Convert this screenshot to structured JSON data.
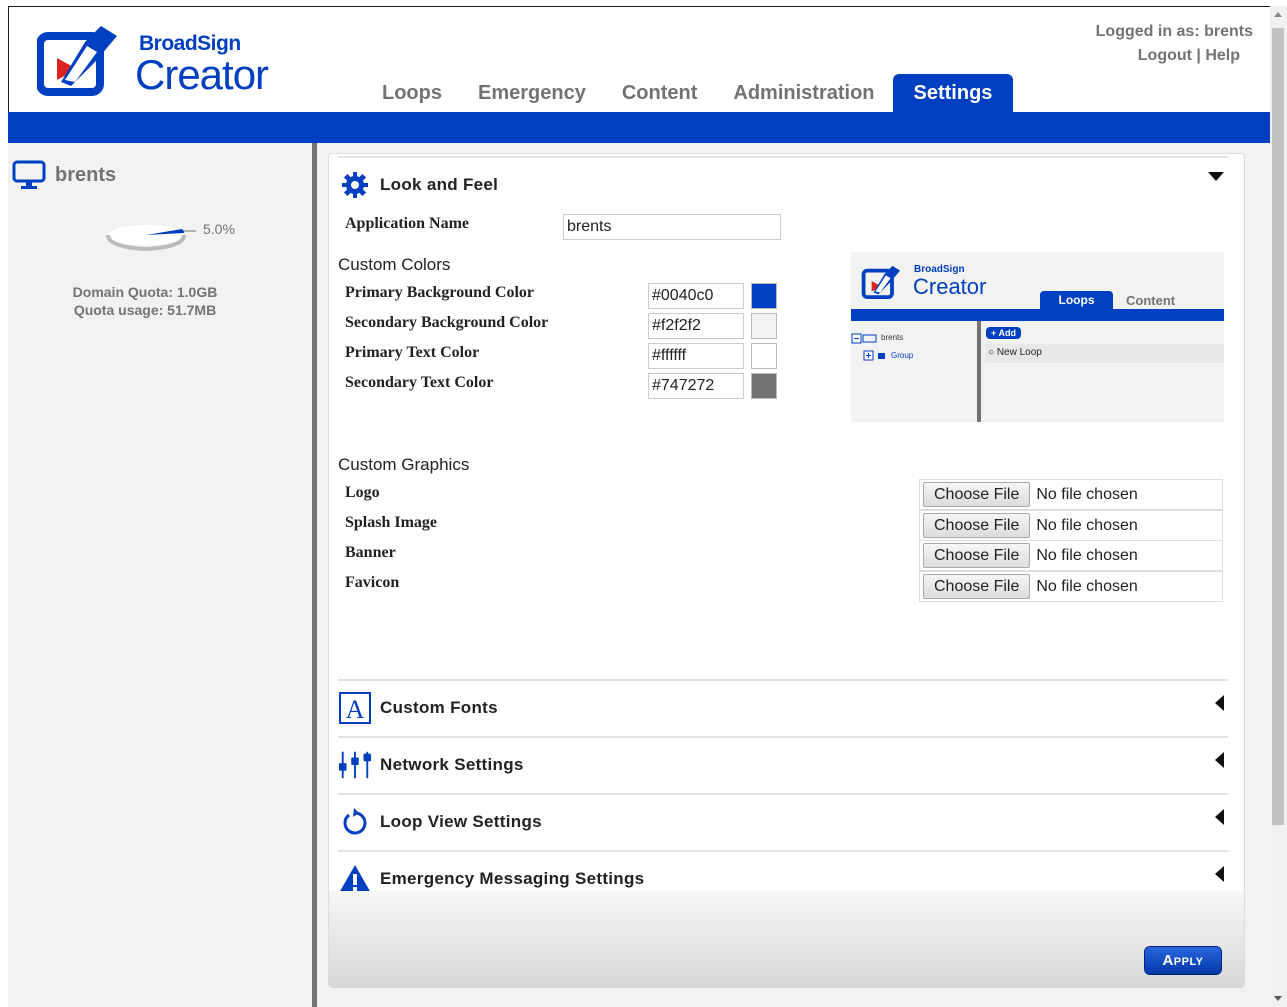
{
  "app": {
    "logo_sup": "BroadSign",
    "logo_main": "Creator"
  },
  "header": {
    "logged_in": "Logged in as: brents",
    "links": "Logout | Help",
    "tabs": [
      {
        "label": "Loops"
      },
      {
        "label": "Emergency"
      },
      {
        "label": "Content"
      },
      {
        "label": "Administration"
      },
      {
        "label": "Settings",
        "active": true
      }
    ]
  },
  "sidebar": {
    "user": "brents",
    "usage_percent_label": "5.0%",
    "usage_fraction": 0.05,
    "domain_quota": "Domain Quota: 1.0GB",
    "quota_usage": "Quota usage: 51.7MB"
  },
  "look_and_feel": {
    "title": "Look and Feel",
    "app_name_label": "Application Name",
    "app_name_value": "brents",
    "custom_colors_label": "Custom Colors",
    "colors": [
      {
        "label": "Primary Background Color",
        "value": "#0040c0"
      },
      {
        "label": "Secondary Background Color",
        "value": "#f2f2f2"
      },
      {
        "label": "Primary Text Color",
        "value": "#ffffff"
      },
      {
        "label": "Secondary Text Color",
        "value": "#747272"
      }
    ],
    "custom_graphics_label": "Custom Graphics",
    "graphics": [
      {
        "label": "Logo",
        "button": "Choose File",
        "status": "No file chosen"
      },
      {
        "label": "Splash Image",
        "button": "Choose File",
        "status": "No file chosen"
      },
      {
        "label": "Banner",
        "button": "Choose File",
        "status": "No file chosen"
      },
      {
        "label": "Favicon",
        "button": "Choose File",
        "status": "No file chosen"
      }
    ],
    "preview": {
      "logo_sup": "BroadSign",
      "logo_main": "Creator",
      "tab_active": "Loops",
      "tab_other": "Content",
      "tree_root": "brents",
      "tree_child": "Group",
      "add_button": "+ Add",
      "loop_item": "New Loop"
    }
  },
  "sections": [
    {
      "title": "Custom Fonts",
      "icon": "font-icon"
    },
    {
      "title": "Network Settings",
      "icon": "network-icon"
    },
    {
      "title": "Loop View Settings",
      "icon": "refresh-icon"
    },
    {
      "title": "Emergency Messaging Settings",
      "icon": "warning-icon"
    }
  ],
  "footer": {
    "apply_label": "Apply"
  },
  "colors": {
    "brand": "#0040c0",
    "secondary_bg": "#f2f2f2",
    "secondary_text": "#747272"
  }
}
